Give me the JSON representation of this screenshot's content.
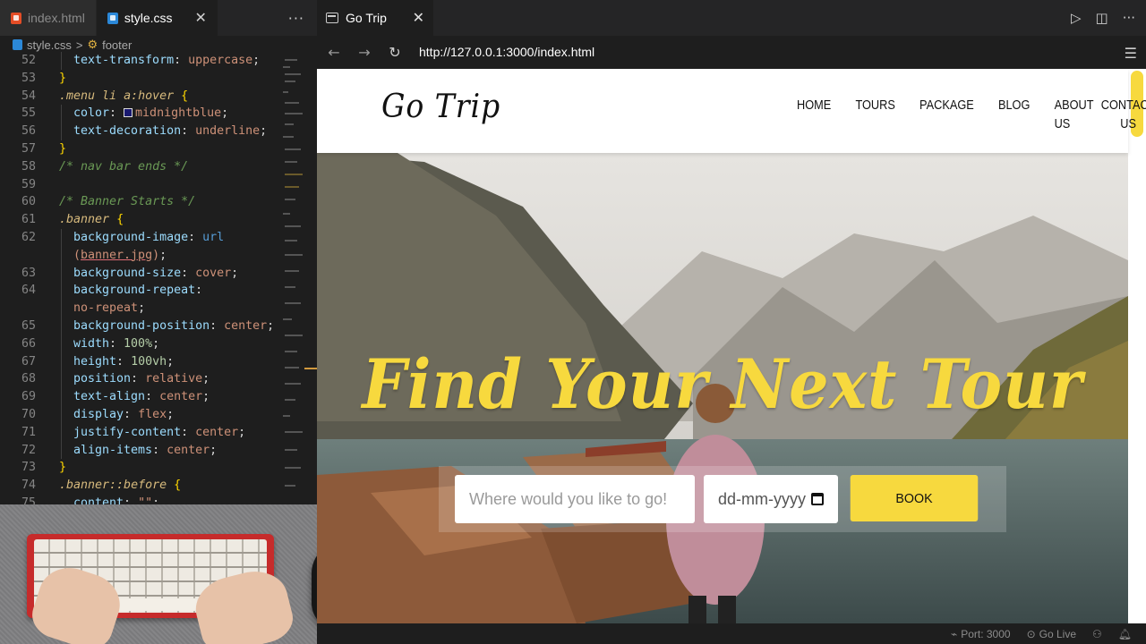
{
  "editor": {
    "tabs": [
      {
        "label": "index.html",
        "icon": "html-file-icon"
      },
      {
        "label": "style.css",
        "icon": "css-file-icon",
        "active": true
      }
    ],
    "more_label": "···",
    "breadcrumb": {
      "file": "style.css",
      "separator": ">",
      "symbol": "footer"
    },
    "line_numbers": [
      "52",
      "53",
      "54",
      "55",
      "56",
      "57",
      "58",
      "59",
      "60",
      "61",
      "62",
      "",
      "63",
      "64",
      "",
      "65",
      "66",
      "67",
      "68",
      "69",
      "70",
      "71",
      "72",
      "73",
      "74",
      "75"
    ],
    "code": {
      "l52_prop": "text-transform",
      "l52_val": "uppercase",
      "l53": "}",
      "l54_sel": ".menu",
      "l54_rest": "li",
      "l54_a": "a",
      "l54_pseudo": ":hover",
      "l55_prop": "color",
      "l55_val": "midnightblue",
      "l56_prop": "text-decoration",
      "l56_val": "underline",
      "l57": "}",
      "l58": "/* nav bar ends */",
      "l60": "/* Banner Starts */",
      "l61_sel": ".banner",
      "l62_prop": "background-image",
      "l62_fn": "url",
      "l62b_val": "banner.jpg",
      "l63_prop": "background-size",
      "l63_val": "cover",
      "l64_prop": "background-repeat",
      "l64b_val": "no-repeat",
      "l65_prop": "background-position",
      "l65_val": "center",
      "l66_prop": "width",
      "l66_val": "100%",
      "l67_prop": "height",
      "l67_val": "100vh",
      "l68_prop": "position",
      "l68_val": "relative",
      "l69_prop": "text-align",
      "l69_val": "center",
      "l70_prop": "display",
      "l70_val": "flex",
      "l71_prop": "justify-content",
      "l71_val": "center",
      "l72_prop": "align-items",
      "l72_val": "center",
      "l73": "}",
      "l74_sel": ".banner",
      "l74_pseudo": "::before",
      "l75_prop": "content",
      "l75_val": "\"\""
    }
  },
  "preview": {
    "tab_label": "Go Trip",
    "url": "http://127.0.0.1:3000/index.html",
    "site": {
      "logo": "Go Trip",
      "menu": [
        "HOME",
        "TOURS",
        "PACKAGE",
        "BLOG",
        "ABOUT US"
      ],
      "menu_contact_line1": "CONTACT",
      "menu_contact_line2": "US",
      "headline": "Find Your Next Tour",
      "where_placeholder": "Where would you like to go!",
      "date_placeholder": "dd-mm-yyyy",
      "book_label": "BOOK"
    },
    "accent_color": "#f7d93e"
  },
  "statusbar": {
    "port": "Port: 3000",
    "go_live": "Go Live"
  }
}
